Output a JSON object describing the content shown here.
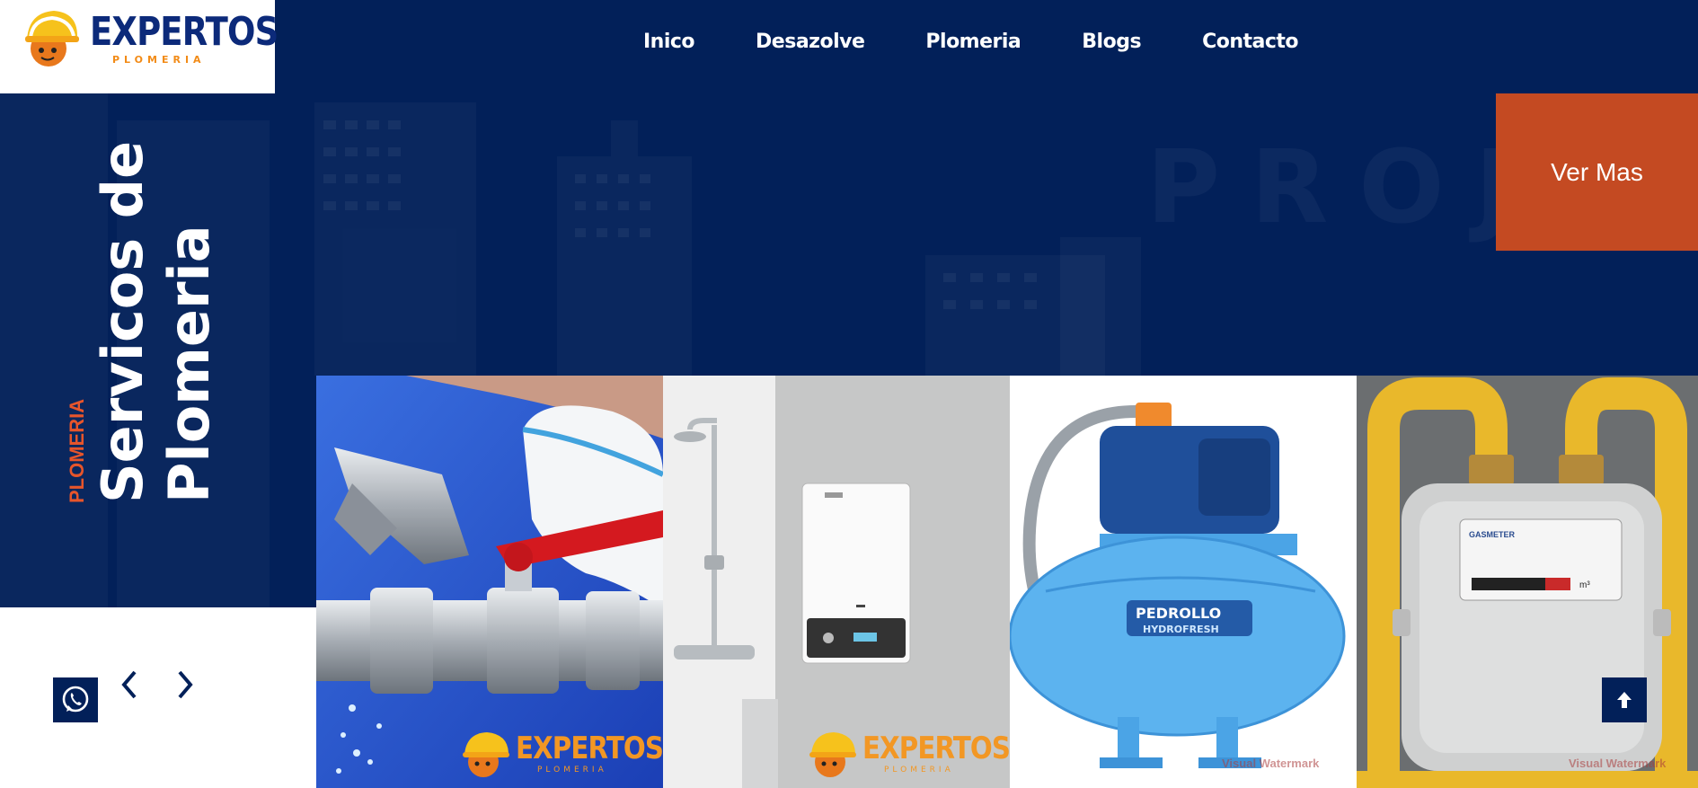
{
  "brand": {
    "name": "EXPERTOS",
    "tagline": "PLOMERIA"
  },
  "nav": {
    "items": [
      "Inico",
      "Desazolve",
      "Plomeria",
      "Blogs",
      "Contacto"
    ]
  },
  "hero": {
    "eyebrow": "PLOMERIA",
    "title_line1": "Servicos de",
    "title_line2": "Plomeria",
    "ghost_text": "PROJECTS",
    "cta_label": "Ver Mas"
  },
  "gallery": {
    "tiles": [
      {
        "subject": "wrench and valve",
        "brand": "EXPERTOS",
        "brand_sub": "PLOMERIA"
      },
      {
        "subject": "water heater and shower",
        "brand": "EXPERTOS",
        "brand_sub": "PLOMERIA"
      },
      {
        "subject": "pressure pump",
        "pump_brand": "PEDROLLO",
        "pump_model": "HYDROFRESH",
        "watermark": "Visual Watermark"
      },
      {
        "subject": "gas meter",
        "meter_label": "GASMETER",
        "meter_unit": "m³",
        "watermark": "Visual Watermark"
      }
    ]
  },
  "icons": {
    "whatsapp": "whatsapp-icon",
    "prev": "chevron-left-icon",
    "next": "chevron-right-icon",
    "top": "arrow-up-icon"
  },
  "colors": {
    "navy": "#022059",
    "accent": "#c44a22",
    "orange_text": "#e7552b",
    "logo_blue": "#0c2a7a",
    "logo_orange": "#f28b17"
  }
}
